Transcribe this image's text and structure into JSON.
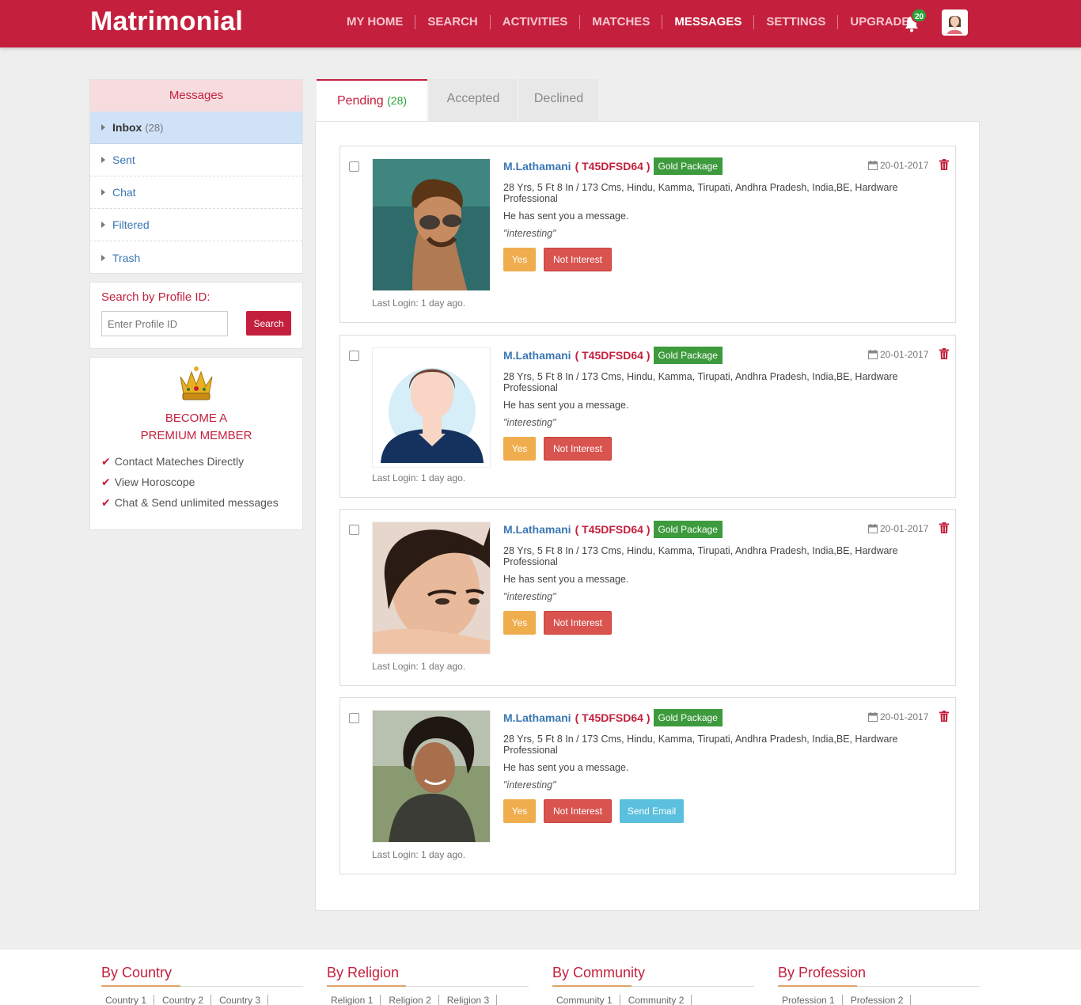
{
  "header": {
    "brand": "Matrimonial",
    "nav": [
      "MY HOME",
      "SEARCH",
      "ACTIVITIES",
      "MATCHES",
      "MESSAGES",
      "SETTINGS",
      "UPGRADE"
    ],
    "active_nav": "MESSAGES",
    "notification_count": "20"
  },
  "sidebar": {
    "title": "Messages",
    "items": [
      {
        "label": "Inbox",
        "count": "(28)"
      },
      {
        "label": "Sent"
      },
      {
        "label": "Chat"
      },
      {
        "label": "Filtered"
      },
      {
        "label": "Trash"
      }
    ],
    "search": {
      "title": "Search by Profile ID:",
      "placeholder": "Enter Profile ID",
      "button": "Search"
    },
    "premium": {
      "title_line1": "BECOME A",
      "title_line2": "PREMIUM MEMBER",
      "perks": [
        "Contact Mateches Directly",
        "View Horoscope",
        "Chat & Send unlimited messages"
      ]
    }
  },
  "tabs": [
    {
      "label": "Pending",
      "count": "(28)"
    },
    {
      "label": "Accepted"
    },
    {
      "label": "Declined"
    }
  ],
  "cards": [
    {
      "name": "M.Lathamani",
      "profile_id": "( T45DFSD64 )",
      "package": "Gold Package",
      "date": "20-01-2017",
      "details": "28 Yrs, 5 Ft 8 In / 173 Cms, Hindu, Kamma, Tirupati, Andhra Pradesh, India,BE, Hardware Professional",
      "message": "He has sent you a message.",
      "quote": "\"interesting\"",
      "yes": "Yes",
      "no": "Not Interest",
      "last_login": "Last Login: 1 day ago."
    },
    {
      "name": "M.Lathamani",
      "profile_id": "( T45DFSD64 )",
      "package": "Gold Package",
      "date": "20-01-2017",
      "details": "28 Yrs, 5 Ft 8 In / 173 Cms, Hindu, Kamma, Tirupati, Andhra Pradesh, India,BE, Hardware Professional",
      "message": "He has sent you a message.",
      "quote": "\"interesting\"",
      "yes": "Yes",
      "no": "Not Interest",
      "last_login": "Last Login: 1 day ago."
    },
    {
      "name": "M.Lathamani",
      "profile_id": "( T45DFSD64 )",
      "package": "Gold Package",
      "date": "20-01-2017",
      "details": "28 Yrs, 5 Ft 8 In / 173 Cms, Hindu, Kamma, Tirupati, Andhra Pradesh, India,BE, Hardware Professional",
      "message": "He has sent you a message.",
      "quote": "\"interesting\"",
      "yes": "Yes",
      "no": "Not Interest",
      "last_login": "Last Login: 1 day ago."
    },
    {
      "name": "M.Lathamani",
      "profile_id": "( T45DFSD64 )",
      "package": "Gold Package",
      "date": "20-01-2017",
      "details": "28 Yrs, 5 Ft 8 In / 173 Cms, Hindu, Kamma, Tirupati, Andhra Pradesh, India,BE, Hardware Professional",
      "message": "He has sent you a message.",
      "quote": "\"interesting\"",
      "yes": "Yes",
      "no": "Not Interest",
      "email": "Send Email",
      "last_login": "Last Login: 1 day ago."
    }
  ],
  "footer": [
    {
      "title": "By Country",
      "links": [
        "Country 1",
        "Country 2",
        "Country 3"
      ]
    },
    {
      "title": "By Religion",
      "links": [
        "Religion 1",
        "Religion 2",
        "Religion 3"
      ]
    },
    {
      "title": "By Community",
      "links": [
        "Community 1",
        "Community 2"
      ]
    },
    {
      "title": "By Profession",
      "links": [
        "Profession 1",
        "Profession 2"
      ]
    }
  ],
  "colors": {
    "brand": "#c4203d",
    "success": "#3d9a3d",
    "warning": "#f0ad4e",
    "danger": "#d9534f",
    "info": "#5bc0de",
    "link": "#3a77b3"
  },
  "icons": [
    "bell-icon",
    "user-avatar-icon",
    "caret-right-icon",
    "crown-icon",
    "check-icon",
    "calendar-icon",
    "trash-icon"
  ]
}
